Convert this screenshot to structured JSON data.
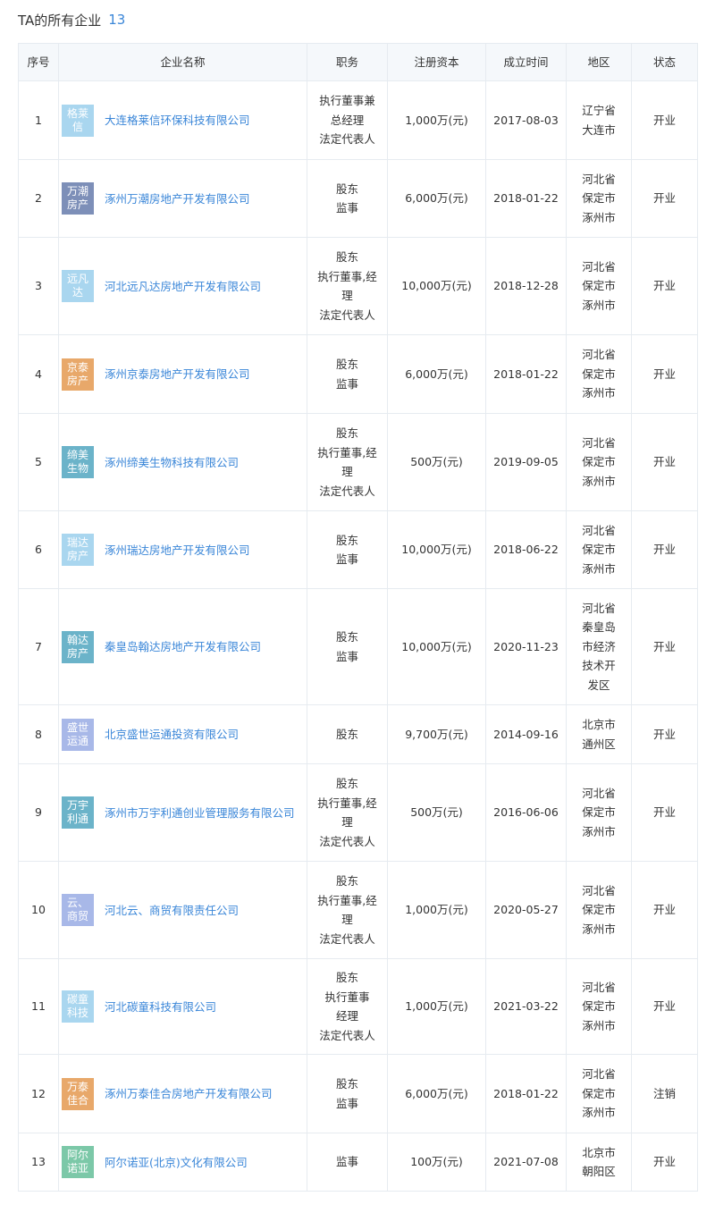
{
  "header": {
    "title": "TA的所有企业",
    "count": "13"
  },
  "table": {
    "columns": [
      "序号",
      "企业名称",
      "职务",
      "注册资本",
      "成立时间",
      "地区",
      "状态"
    ],
    "rows": [
      {
        "idx": "1",
        "logo": "格莱信",
        "logo_color": "#a9d6ef",
        "name": "大连格莱信环保科技有限公司",
        "positions": [
          "执行董事兼",
          "总经理",
          "法定代表人"
        ],
        "capital": "1,000万(元)",
        "date": "2017-08-03",
        "region": [
          "辽宁省",
          "大连市"
        ],
        "status": "开业",
        "status_type": "open",
        "h": 88
      },
      {
        "idx": "2",
        "logo": "万潮房产",
        "logo_color": "#7d8fb8",
        "name": "涿州万潮房地产开发有限公司",
        "positions": [
          "股东",
          "监事"
        ],
        "capital": "6,000万(元)",
        "date": "2018-01-22",
        "region": [
          "河北省",
          "保定市",
          "涿州市"
        ],
        "status": "开业",
        "status_type": "open",
        "h": 87
      },
      {
        "idx": "3",
        "logo": "远凡达",
        "logo_color": "#a9d6ef",
        "name": "河北远凡达房地产开发有限公司",
        "positions": [
          "股东",
          "执行董事,经",
          "理",
          "法定代表人"
        ],
        "capital": "10,000万(元)",
        "date": "2018-12-28",
        "region": [
          "河北省",
          "保定市",
          "涿州市"
        ],
        "status": "开业",
        "status_type": "open",
        "h": 109
      },
      {
        "idx": "4",
        "logo": "京泰房产",
        "logo_color": "#e8a86a",
        "name": "涿州京泰房地产开发有限公司",
        "positions": [
          "股东",
          "监事"
        ],
        "capital": "6,000万(元)",
        "date": "2018-01-22",
        "region": [
          "河北省",
          "保定市",
          "涿州市"
        ],
        "status": "开业",
        "status_type": "open",
        "h": 88
      },
      {
        "idx": "5",
        "logo": "缔美生物",
        "logo_color": "#6bb3c9",
        "name": "涿州缔美生物科技有限公司",
        "positions": [
          "股东",
          "执行董事,经",
          "理",
          "法定代表人"
        ],
        "capital": "500万(元)",
        "date": "2019-09-05",
        "region": [
          "河北省",
          "保定市",
          "涿州市"
        ],
        "status": "开业",
        "status_type": "open",
        "h": 109
      },
      {
        "idx": "6",
        "logo": "瑞达房产",
        "logo_color": "#a9d6ef",
        "name": "涿州瑞达房地产开发有限公司",
        "positions": [
          "股东",
          "监事"
        ],
        "capital": "10,000万(元)",
        "date": "2018-06-22",
        "region": [
          "河北省",
          "保定市",
          "涿州市"
        ],
        "status": "开业",
        "status_type": "open",
        "h": 87
      },
      {
        "idx": "7",
        "logo": "翰达房产",
        "logo_color": "#6bb3c9",
        "name": "秦皇岛翰达房地产开发有限公司",
        "positions": [
          "股东",
          "监事"
        ],
        "capital": "10,000万(元)",
        "date": "2020-11-23",
        "region": [
          "河北省",
          "秦皇岛",
          "市经济",
          "技术开",
          "发区"
        ],
        "status": "开业",
        "status_type": "open",
        "h": 130
      },
      {
        "idx": "8",
        "logo": "盛世运通",
        "logo_color": "#a8b8e8",
        "name": "北京盛世运通投资有限公司",
        "positions": [
          "股东"
        ],
        "capital": "9,700万(元)",
        "date": "2014-09-16",
        "region": [
          "北京市",
          "通州区"
        ],
        "status": "开业",
        "status_type": "open",
        "h": 66
      },
      {
        "idx": "9",
        "logo": "万宇利通",
        "logo_color": "#6bb3c9",
        "name": "涿州市万宇利通创业管理服务有限公司",
        "positions": [
          "股东",
          "执行董事,经",
          "理",
          "法定代表人"
        ],
        "capital": "500万(元)",
        "date": "2016-06-06",
        "region": [
          "河北省",
          "保定市",
          "涿州市"
        ],
        "status": "开业",
        "status_type": "open",
        "h": 109
      },
      {
        "idx": "10",
        "logo": "云、商贸",
        "logo_color": "#a8b8e8",
        "name": "河北云、商贸有限责任公司",
        "positions": [
          "股东",
          "执行董事,经",
          "理",
          "法定代表人"
        ],
        "capital": "1,000万(元)",
        "date": "2020-05-27",
        "region": [
          "河北省",
          "保定市",
          "涿州市"
        ],
        "status": "开业",
        "status_type": "open",
        "h": 109
      },
      {
        "idx": "11",
        "logo": "碳童科技",
        "logo_color": "#a9d6ef",
        "name": "河北碳童科技有限公司",
        "positions": [
          "股东",
          "执行董事",
          "经理",
          "法定代表人"
        ],
        "capital": "1,000万(元)",
        "date": "2021-03-22",
        "region": [
          "河北省",
          "保定市",
          "涿州市"
        ],
        "status": "开业",
        "status_type": "open",
        "h": 107
      },
      {
        "idx": "12",
        "logo": "万泰佳合",
        "logo_color": "#e8a86a",
        "name": "涿州万泰佳合房地产开发有限公司",
        "positions": [
          "股东",
          "监事"
        ],
        "capital": "6,000万(元)",
        "date": "2018-01-22",
        "region": [
          "河北省",
          "保定市",
          "涿州市"
        ],
        "status": "注销",
        "status_type": "cancel",
        "h": 88
      },
      {
        "idx": "13",
        "logo": "阿尔诺亚",
        "logo_color": "#7cc8a8",
        "name": "阿尔诺亚(北京)文化有限公司",
        "positions": [
          "监事"
        ],
        "capital": "100万(元)",
        "date": "2021-07-08",
        "region": [
          "北京市",
          "朝阳区"
        ],
        "status": "开业",
        "status_type": "open",
        "h": 65
      }
    ]
  }
}
